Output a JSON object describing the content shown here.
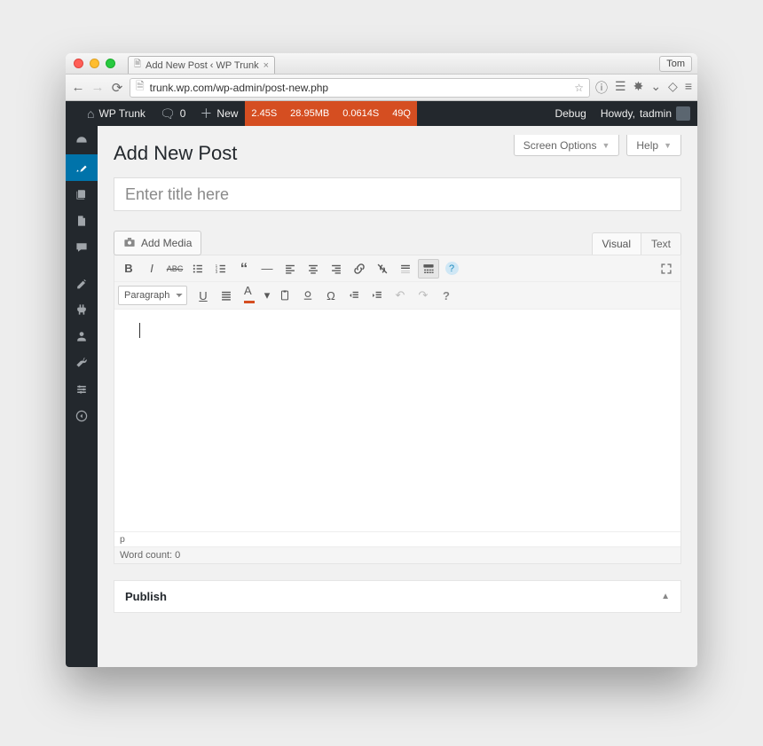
{
  "browser": {
    "tab_title": "Add New Post ‹ WP Trunk",
    "profile_button": "Tom",
    "url": "trunk.wp.com/wp-admin/post-new.php"
  },
  "adminbar": {
    "site_name": "WP Trunk",
    "comment_count": "0",
    "new_label": "New",
    "debug_stats": [
      "2.45S",
      "28.95MB",
      "0.0614S",
      "49Q"
    ],
    "debug_link": "Debug",
    "howdy_prefix": "Howdy, ",
    "howdy_user": "tadmin"
  },
  "screen_actions": {
    "screen_options": "Screen Options",
    "help": "Help"
  },
  "page": {
    "title": "Add New Post",
    "title_placeholder": "Enter title here",
    "add_media_label": "Add Media",
    "tab_visual": "Visual",
    "tab_text": "Text",
    "paragraph_select": "Paragraph",
    "path_element": "p",
    "word_count_label": "Word count: 0"
  },
  "publish": {
    "title": "Publish"
  }
}
